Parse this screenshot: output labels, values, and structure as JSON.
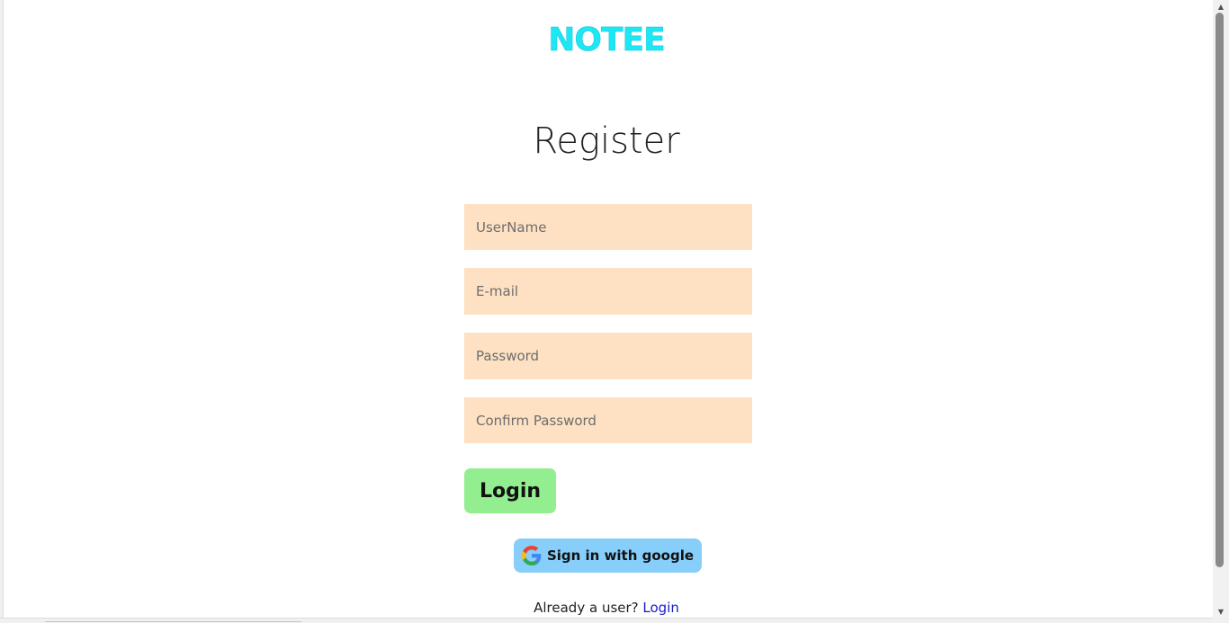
{
  "brand": {
    "name": "NOTEE"
  },
  "page": {
    "title": "Register"
  },
  "form": {
    "username_placeholder": "UserName",
    "email_placeholder": "E-mail",
    "password_placeholder": "Password",
    "confirm_password_placeholder": "Confirm Password",
    "submit_label": "Login"
  },
  "google": {
    "label": "Sign in with google",
    "icon": "google-g-icon"
  },
  "footer": {
    "prompt": "Already a user?",
    "link_label": "Login"
  },
  "colors": {
    "brand": "#1de6f5",
    "field_background": "#fde1c2",
    "submit_background": "#92ee8f",
    "google_background": "#87cefa",
    "link": "#1a1acc"
  }
}
